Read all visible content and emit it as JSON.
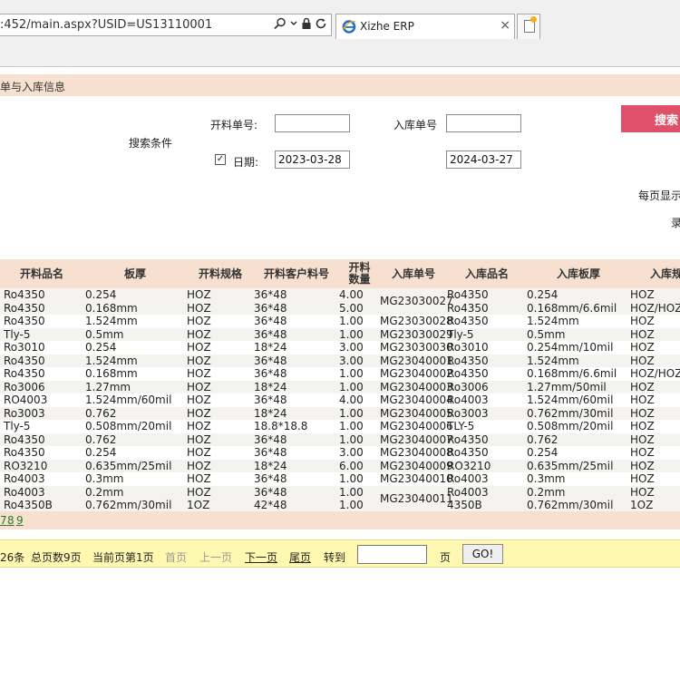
{
  "browser": {
    "address": ":452/main.aspx?USID=US13110001",
    "tab_title": "Xizhe ERP",
    "tab_close": "×"
  },
  "page": {
    "title": "单与入库信息",
    "search_conditions_label": "搜索条件",
    "cut_order_label": "开料单号:",
    "cut_order_value": "",
    "in_order_label": "入库单号",
    "in_order_value": "",
    "date_checked": true,
    "date_check_glyph": "✓",
    "date_label": "日期:",
    "date_from": "2023-03-28",
    "date_to": "2024-03-27",
    "search_button": "搜索",
    "per_page_label": "每页显示",
    "record_label": "录"
  },
  "table": {
    "headers": [
      "开料品名",
      "板厚",
      "开料规格",
      "开料客户料号",
      "开料数量",
      "入库单号",
      "入库品名",
      "入库板厚",
      "入库规"
    ],
    "groups": [
      {
        "in_no": "MG23030027",
        "lines": [
          [
            "Ro4350",
            "0.254",
            "HOZ",
            "36*48",
            "4.00",
            "Ro4350",
            "0.254",
            "HOZ"
          ],
          [
            "Ro4350",
            "0.168mm",
            "HOZ",
            "36*48",
            "5.00",
            "Ro4350",
            "0.168mm/6.6mil",
            "HOZ/HOZ"
          ]
        ]
      },
      {
        "in_no": "MG23030028",
        "lines": [
          [
            "Ro4350",
            "1.524mm",
            "HOZ",
            "36*48",
            "1.00",
            "Ro4350",
            "1.524mm",
            "HOZ"
          ]
        ]
      },
      {
        "in_no": "MG23030029",
        "lines": [
          [
            "Tly-5",
            "0.5mm",
            "HOZ",
            "36*48",
            "1.00",
            "Tly-5",
            "0.5mm",
            "HOZ"
          ]
        ]
      },
      {
        "in_no": "MG23030030",
        "lines": [
          [
            "Ro3010",
            "0.254",
            "HOZ",
            "18*24",
            "3.00",
            "Ro3010",
            "0.254mm/10mil",
            "HOZ"
          ]
        ]
      },
      {
        "in_no": "MG23040001",
        "lines": [
          [
            "Ro4350",
            "1.524mm",
            "HOZ",
            "36*48",
            "3.00",
            "Ro4350",
            "1.524mm",
            "HOZ"
          ]
        ]
      },
      {
        "in_no": "MG23040002",
        "lines": [
          [
            "Ro4350",
            "0.168mm",
            "HOZ",
            "36*48",
            "1.00",
            "Ro4350",
            "0.168mm/6.6mil",
            "HOZ/HOZ"
          ]
        ]
      },
      {
        "in_no": "MG23040003",
        "lines": [
          [
            "Ro3006",
            "1.27mm",
            "HOZ",
            "18*24",
            "1.00",
            "Ro3006",
            "1.27mm/50mil",
            "HOZ"
          ]
        ]
      },
      {
        "in_no": "MG23040004",
        "lines": [
          [
            "RO4003",
            "1.524mm/60mil",
            "HOZ",
            "36*48",
            "4.00",
            "Ro4003",
            "1.524mm/60mil",
            "HOZ"
          ]
        ]
      },
      {
        "in_no": "MG23040005",
        "lines": [
          [
            "Ro3003",
            "0.762",
            "HOZ",
            "18*24",
            "1.00",
            "Ro3003",
            "0.762mm/30mil",
            "HOZ"
          ]
        ]
      },
      {
        "in_no": "MG23040006",
        "lines": [
          [
            "Tly-5",
            "0.508mm/20mil",
            "HOZ",
            "18.8*18.8",
            "1.00",
            "TLY-5",
            "0.508mm/20mil",
            "HOZ"
          ]
        ]
      },
      {
        "in_no": "MG23040007",
        "lines": [
          [
            "Ro4350",
            "0.762",
            "HOZ",
            "36*48",
            "1.00",
            "Ro4350",
            "0.762",
            "HOZ"
          ]
        ]
      },
      {
        "in_no": "MG23040008",
        "lines": [
          [
            "Ro4350",
            "0.254",
            "HOZ",
            "36*48",
            "3.00",
            "Ro4350",
            "0.254",
            "HOZ"
          ]
        ]
      },
      {
        "in_no": "MG23040009",
        "lines": [
          [
            "RO3210",
            "0.635mm/25mil",
            "HOZ",
            "18*24",
            "6.00",
            "RO3210",
            "0.635mm/25mil",
            "HOZ"
          ]
        ]
      },
      {
        "in_no": "MG23040010",
        "lines": [
          [
            "Ro4003",
            "0.3mm",
            "HOZ",
            "36*48",
            "1.00",
            "Ro4003",
            "0.3mm",
            "HOZ"
          ]
        ]
      },
      {
        "in_no": "MG23040011",
        "lines": [
          [
            "Ro4003",
            "0.2mm",
            "HOZ",
            "36*48",
            "1.00",
            "Ro4003",
            "0.2mm",
            "HOZ"
          ],
          [
            "Ro4350B",
            "0.762mm/30mil",
            "1OZ",
            "42*48",
            "1.00",
            "4350B",
            "0.762mm/30mil",
            "1OZ"
          ]
        ]
      }
    ],
    "page_links": [
      "7",
      "8",
      "9"
    ]
  },
  "pager": {
    "total_records": "26条",
    "total_pages": "总页数9页",
    "current_page": "当前页第1页",
    "first": "首页",
    "prev": "上一页",
    "next": "下一页",
    "last": "尾页",
    "goto": "转到",
    "page_unit": "页",
    "go_button": "GO!"
  }
}
